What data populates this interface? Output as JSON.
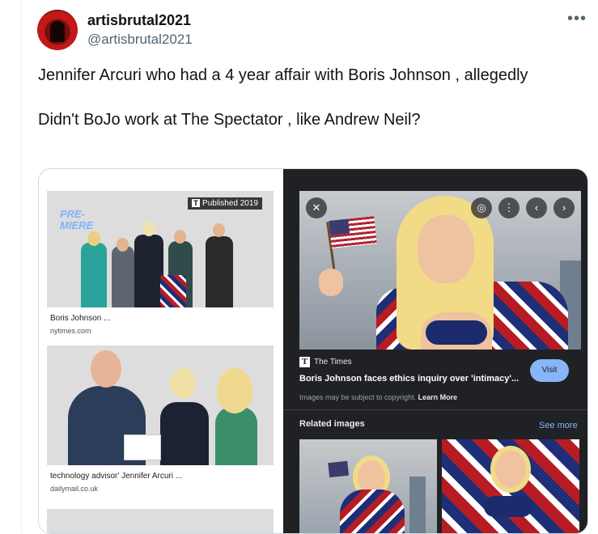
{
  "tweet": {
    "author_name": "artisbrutal2021",
    "author_handle": "@artisbrutal2021",
    "more_icon": "•••",
    "text_lines": [
      "Jennifer Arcuri who had a 4 year affair with Boris Johnson , allegedly",
      "Didn't BoJo work at The Spectator , like Andrew Neil?"
    ]
  },
  "results": [
    {
      "caption": "Boris Johnson ...",
      "domain": "nytimes.com",
      "badge": "Published 2019",
      "badge_mark": "T",
      "overlay_text": "PRE-\nMIERE"
    },
    {
      "caption": "technology advisor' Jennifer Arcuri ...",
      "domain": "dailymail.co.uk"
    }
  ],
  "viewer": {
    "controls": {
      "close": "✕",
      "lens": "◎",
      "more": "⋮",
      "prev": "‹",
      "next": "›"
    },
    "source_logo": "T",
    "source": "The Times",
    "title": "Boris Johnson faces ethics inquiry over 'intimacy'...",
    "visit_label": "Visit",
    "copyright_text": "Images may be subject to copyright.",
    "learn_more": "Learn More",
    "related_title": "Related images",
    "see_more": "See more"
  }
}
